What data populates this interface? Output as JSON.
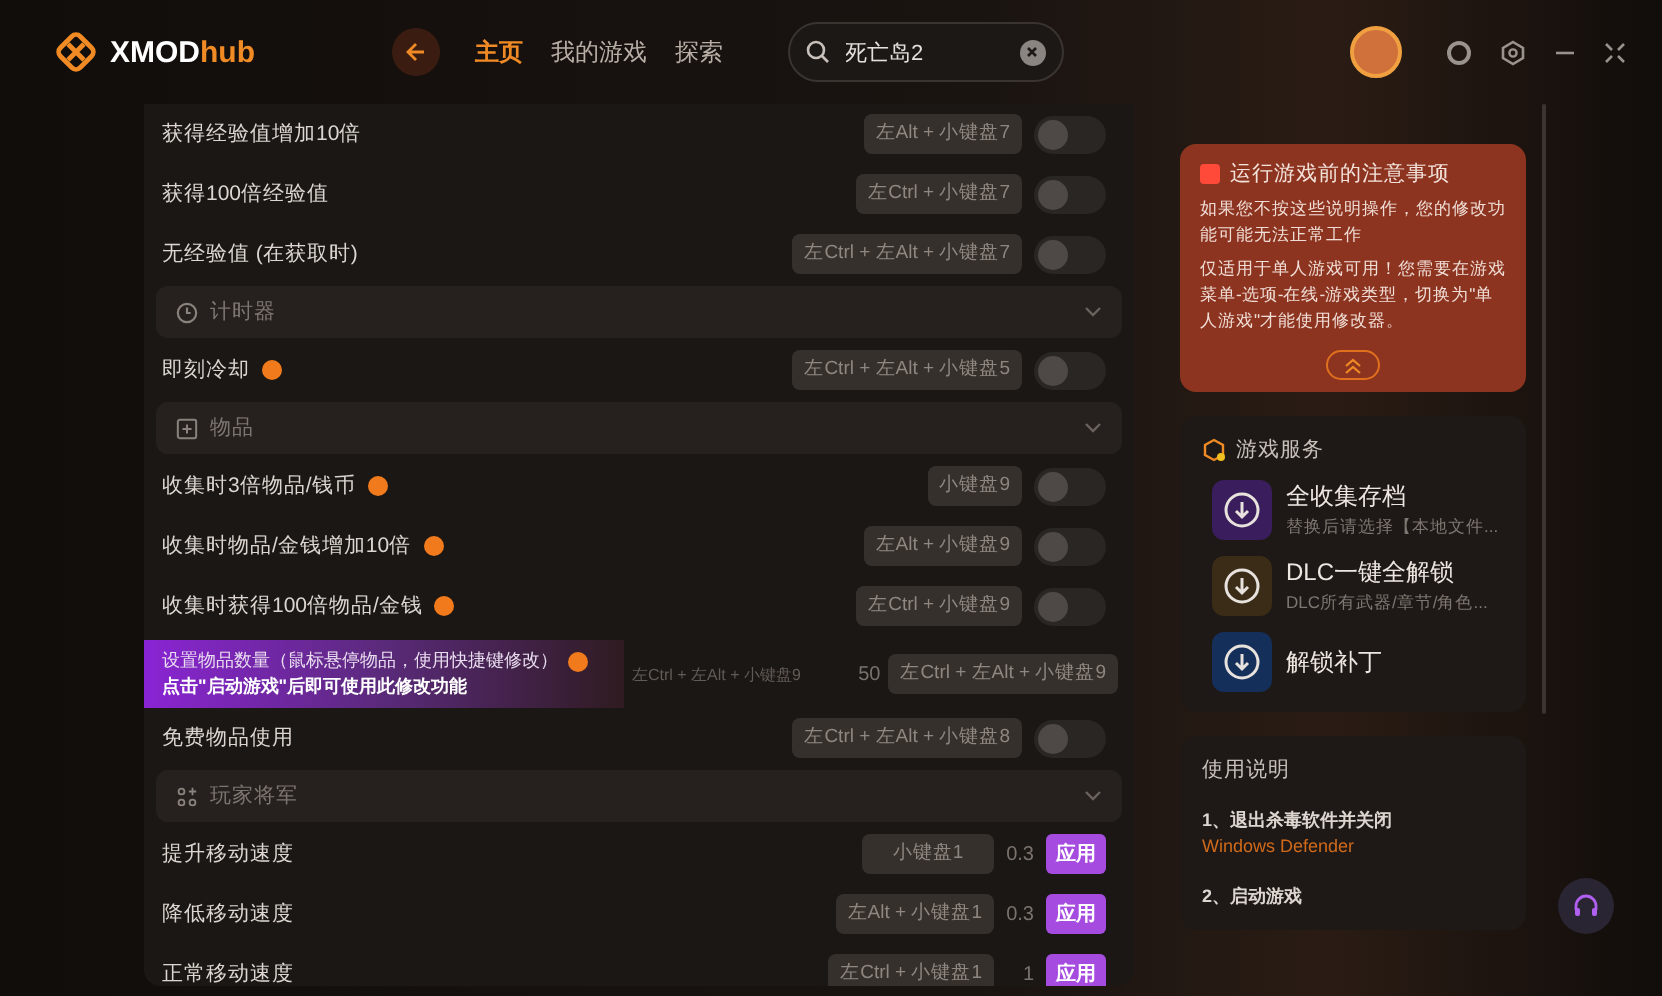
{
  "header": {
    "logo": {
      "prefix": "XMOD",
      "suffix": "hub"
    },
    "nav": [
      {
        "label": "主页",
        "selected": true
      },
      {
        "label": "我的游戏",
        "selected": false
      },
      {
        "label": "探索",
        "selected": false
      }
    ],
    "search": {
      "value": "死亡岛2"
    }
  },
  "list": [
    {
      "kind": "toggle",
      "label": "获得经验值增加10倍",
      "info": false,
      "hotkey": "左Alt + 小键盘7",
      "on": false
    },
    {
      "kind": "toggle",
      "label": "获得100倍经验值",
      "info": false,
      "hotkey": "左Ctrl + 小键盘7",
      "on": false
    },
    {
      "kind": "toggle",
      "label": "无经验值 (在获取时)",
      "info": false,
      "hotkey": "左Ctrl + 左Alt + 小键盘7",
      "on": false
    },
    {
      "kind": "section",
      "label": "计时器"
    },
    {
      "kind": "toggle",
      "label": "即刻冷却",
      "info": true,
      "hotkey": "左Ctrl + 左Alt + 小键盘5",
      "on": false
    },
    {
      "kind": "section",
      "label": "物品"
    },
    {
      "kind": "toggle",
      "label": "收集时3倍物品/钱币",
      "info": true,
      "hotkey": "小键盘9",
      "on": false
    },
    {
      "kind": "toggle",
      "label": "收集时物品/金钱增加10倍",
      "info": true,
      "hotkey": "左Alt + 小键盘9",
      "on": false
    },
    {
      "kind": "toggle",
      "label": "收集时获得100倍物品/金钱",
      "info": true,
      "hotkey": "左Ctrl + 小键盘9",
      "on": false
    },
    {
      "kind": "input",
      "label": "设置物品数量（鼠标悬停物品，使用快捷键修改）",
      "info": true,
      "tooltip": "点击\"启动游戏\"后即可使用此修改功能",
      "hint_hotkey": "左Ctrl + 左Alt + 小键盘9",
      "value": "50",
      "hotkey": "左Ctrl + 左Alt + 小键盘9"
    },
    {
      "kind": "toggle",
      "label": "免费物品使用",
      "info": false,
      "hotkey": "左Ctrl + 左Alt + 小键盘8",
      "on": false
    },
    {
      "kind": "section",
      "label": "玩家将军"
    },
    {
      "kind": "apply",
      "label": "提升移动速度",
      "hotkey": "小键盘1",
      "value": "0.3",
      "button": "应用"
    },
    {
      "kind": "apply",
      "label": "降低移动速度",
      "hotkey": "左Alt + 小键盘1",
      "value": "0.3",
      "button": "应用"
    },
    {
      "kind": "apply",
      "label": "正常移动速度",
      "hotkey": "左Ctrl + 小键盘1",
      "value": "1",
      "button": "应用"
    }
  ],
  "notice": {
    "title": "运行游戏前的注意事项",
    "paragraphs": [
      "如果您不按这些说明操作，您的修改功能可能无法正常工作",
      "仅适用于单人游戏可用！您需要在游戏菜单-选项-在线-游戏类型，切换为\"单人游戏\"才能使用修改器。"
    ]
  },
  "services": {
    "title": "游戏服务",
    "items": [
      {
        "title": "全收集存档",
        "subtitle": "替换后请选择【本地文件...",
        "color": "#3a1d5c"
      },
      {
        "title": "DLC一键全解锁",
        "subtitle": "DLC所有武器/章节/角色...",
        "color": "#3b2c18"
      },
      {
        "title": "解锁补丁",
        "color": "#14305a"
      }
    ]
  },
  "usage": {
    "title": "使用说明",
    "steps": [
      {
        "text": "1、退出杀毒软件并关闭",
        "link": "Windows Defender"
      },
      {
        "text": "2、启动游戏"
      }
    ]
  }
}
